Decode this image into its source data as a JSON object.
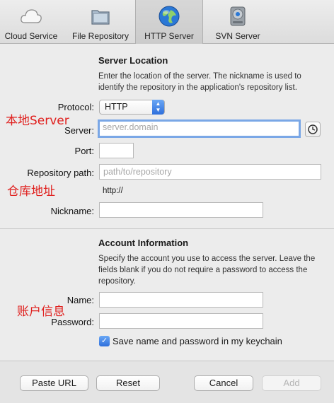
{
  "toolbar": {
    "tabs": [
      {
        "label": "Cloud Service",
        "icon": "cloud-icon"
      },
      {
        "label": "File Repository",
        "icon": "folder-icon"
      },
      {
        "label": "HTTP Server",
        "icon": "globe-icon",
        "active": true
      },
      {
        "label": "SVN Server",
        "icon": "drive-icon"
      }
    ]
  },
  "server": {
    "heading": "Server Location",
    "description": "Enter the location of the server. The nickname is used to identify the repository in the application's repository list.",
    "protocol_label": "Protocol:",
    "protocol_value": "HTTP",
    "server_label": "Server:",
    "server_placeholder": "server.domain",
    "port_label": "Port:",
    "repo_label": "Repository path:",
    "repo_placeholder": "path/to/repository",
    "url_preview": "http://",
    "nickname_label": "Nickname:"
  },
  "account": {
    "heading": "Account Information",
    "description": "Specify the account you use to access the server. Leave the fields blank if you do not require a password to access the repository.",
    "name_label": "Name:",
    "password_label": "Password:",
    "save_keychain_label": "Save name and password in my keychain",
    "save_keychain_checked": true
  },
  "annotations": {
    "local_server": "本地Server",
    "repo_address": "仓库地址",
    "account_info": "账户信息"
  },
  "footer": {
    "paste_url": "Paste URL",
    "reset": "Reset",
    "cancel": "Cancel",
    "add": "Add"
  },
  "colors": {
    "accent": "#2e6fdc",
    "annotation": "#e0201e",
    "focus_ring": "#7aa7e6"
  }
}
